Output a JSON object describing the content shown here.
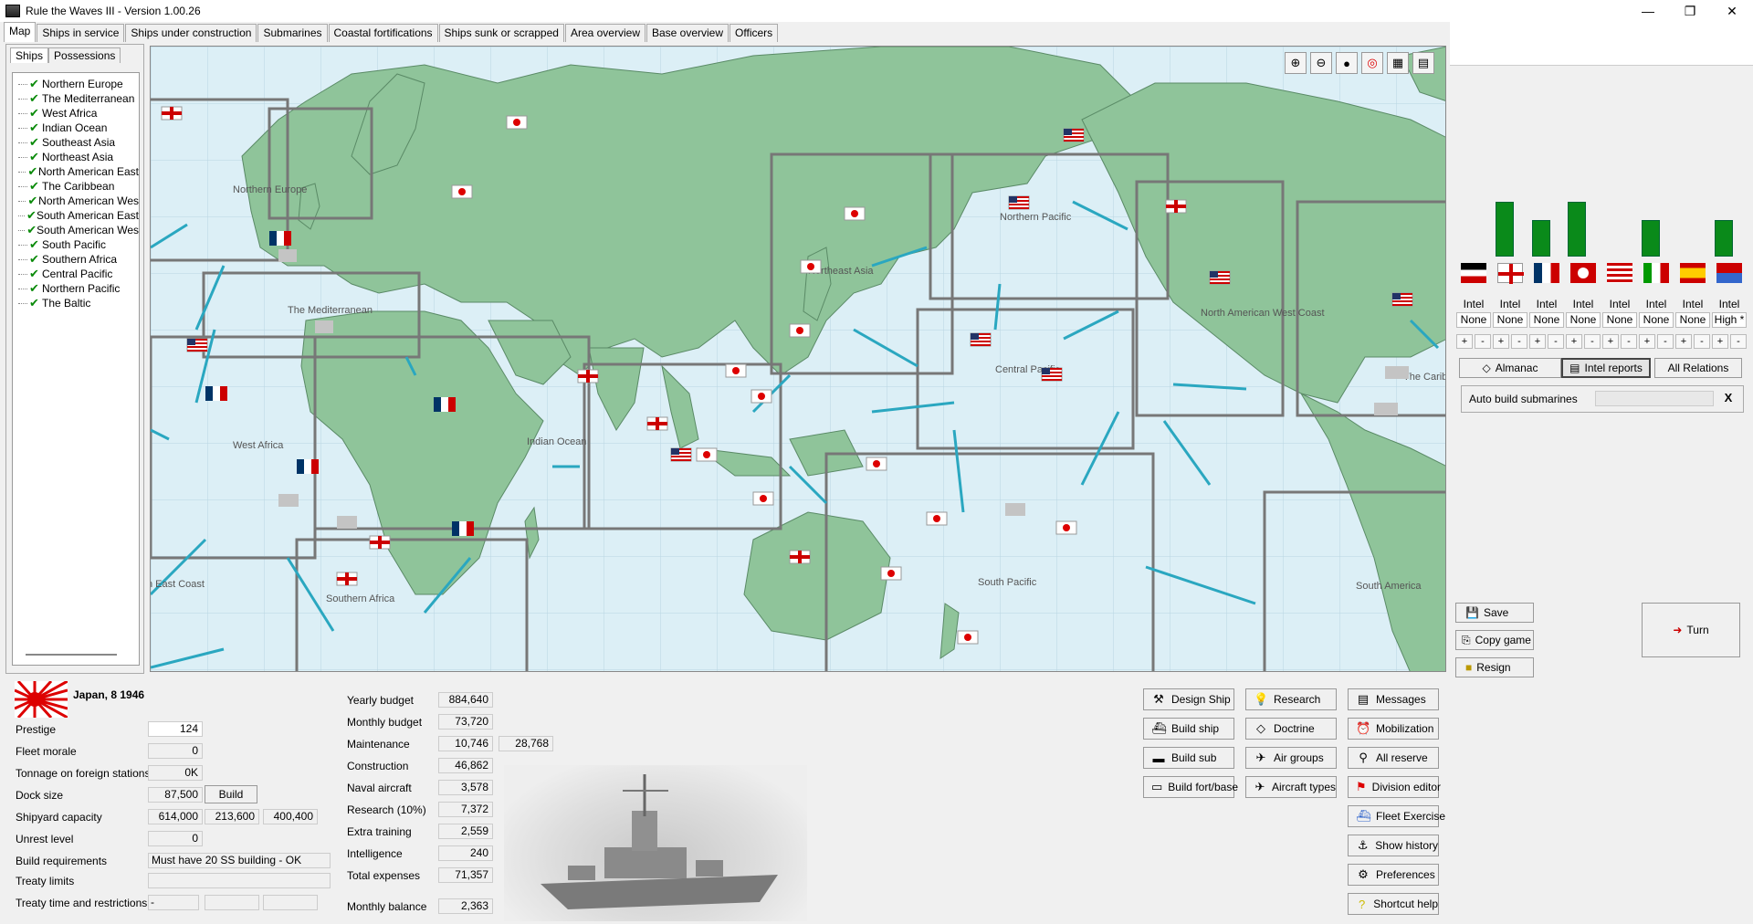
{
  "window": {
    "title": "Rule the Waves III - Version 1.00.26",
    "min": "—",
    "max": "❐",
    "close": "✕"
  },
  "tabs": [
    "Map",
    "Ships in service",
    "Ships under construction",
    "Submarines",
    "Coastal fortifications",
    "Ships sunk or scrapped",
    "Area overview",
    "Base overview",
    "Officers"
  ],
  "subtabs": [
    "Ships",
    "Possessions"
  ],
  "areas": [
    "Northern Europe",
    "The Mediterranean",
    "West Africa",
    "Indian Ocean",
    "Southeast Asia",
    "Northeast Asia",
    "North American East",
    "The Caribbean",
    "North American Wes",
    "South American East",
    "South American Wes",
    "South Pacific",
    "Southern Africa",
    "Central Pacific",
    "Northern Pacific",
    "The Baltic"
  ],
  "map_labels": {
    "northern_europe": "Northern Europe",
    "mediterranean": "The Mediterranean",
    "west_africa": "West Africa",
    "indian_ocean": "Indian Ocean",
    "northeast_asia": "Northeast Asia",
    "northern_pacific": "Northern Pacific",
    "central_pacific": "Central Pacific",
    "south_pacific": "South Pacific",
    "southern_africa": "Southern Africa",
    "na_west_coast": "North American West Coast",
    "south_america": "South America",
    "caribbean": "The Carib",
    "east_coast": "n East Coast"
  },
  "map_tools": [
    "zoom-in",
    "zoom-out",
    "oil",
    "target",
    "flags",
    "grid"
  ],
  "intel": {
    "labels": [
      "Intel",
      "Intel",
      "Intel",
      "Intel",
      "Intel",
      "Intel",
      "Intel",
      "Intel"
    ],
    "values": [
      "None",
      "None",
      "None",
      "None",
      "None",
      "None",
      "None",
      "High *"
    ],
    "bars": [
      0,
      48,
      32,
      48,
      0,
      32,
      0,
      32
    ]
  },
  "right_buttons": {
    "almanac": "Almanac",
    "intel_reports": "Intel reports",
    "all_relations": "All Relations"
  },
  "autobuild": {
    "label": "Auto build submarines",
    "close": "X"
  },
  "side_buttons": {
    "save": "Save",
    "copy_game": "Copy game",
    "resign": "Resign",
    "turn": "Turn"
  },
  "nation": {
    "title": "Japan, 8 1946"
  },
  "stats": {
    "prestige": {
      "label": "Prestige",
      "value": "124"
    },
    "fleet_morale": {
      "label": "Fleet morale",
      "value": "0"
    },
    "tonnage_foreign": {
      "label": "Tonnage on foreign stations",
      "value": "0K"
    },
    "dock_size": {
      "label": "Dock size",
      "value": "87,500",
      "button": "Build"
    },
    "shipyard": {
      "label": "Shipyard capacity",
      "v1": "614,000",
      "v2": "213,600",
      "v3": "400,400"
    },
    "unrest": {
      "label": "Unrest level",
      "value": "0"
    },
    "build_req": {
      "label": "Build requirements",
      "value": "Must have 20 SS building - OK"
    },
    "treaty_limits": {
      "label": "Treaty limits",
      "value": ""
    },
    "treaty_time": {
      "label": "Treaty time and restrictions",
      "value": "-"
    }
  },
  "budget": {
    "yearly": {
      "label": "Yearly budget",
      "value": "884,640"
    },
    "monthly": {
      "label": "Monthly budget",
      "value": "73,720"
    },
    "maintenance": {
      "label": "Maintenance",
      "value": "10,746",
      "value2": "28,768"
    },
    "construction": {
      "label": "Construction",
      "value": "46,862"
    },
    "naval_aircraft": {
      "label": "Naval aircraft",
      "value": "3,578"
    },
    "research": {
      "label": "Research (10%)",
      "value": "7,372"
    },
    "extra_training": {
      "label": "Extra training",
      "value": "2,559"
    },
    "intelligence": {
      "label": "Intelligence",
      "value": "240"
    },
    "total_expenses": {
      "label": "Total expenses",
      "value": "71,357"
    },
    "monthly_balance": {
      "label": "Monthly balance",
      "value": "2,363"
    }
  },
  "actions": {
    "design_ship": "Design Ship",
    "research": "Research",
    "messages": "Messages",
    "build_ship": "Build ship",
    "doctrine": "Doctrine",
    "mobilization": "Mobilization",
    "build_sub": "Build sub",
    "air_groups": "Air groups",
    "all_reserve": "All reserve",
    "build_fort": "Build fort/base",
    "aircraft_types": "Aircraft types",
    "division_editor": "Division editor",
    "fleet_exercise": "Fleet Exercise",
    "show_history": "Show history",
    "preferences": "Preferences",
    "shortcut_help": "Shortcut help"
  }
}
